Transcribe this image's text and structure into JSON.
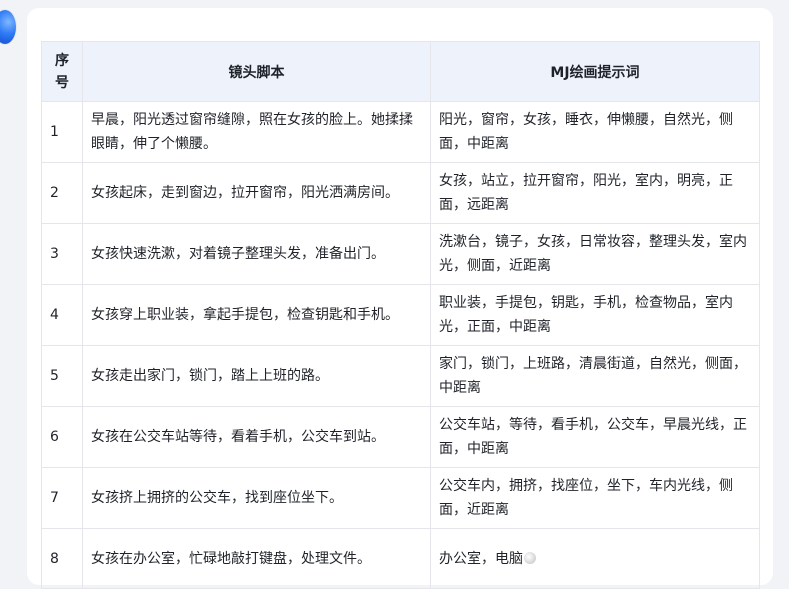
{
  "table": {
    "headers": [
      "序号",
      "镜头脚本",
      "MJ绘画提示词"
    ],
    "rows": [
      {
        "num": "1",
        "script": "早晨，阳光透过窗帘缝隙，照在女孩的脸上。她揉揉眼睛，伸了个懒腰。",
        "prompt": "阳光，窗帘，女孩，睡衣，伸懒腰，自然光，侧面，中距离"
      },
      {
        "num": "2",
        "script": "女孩起床，走到窗边，拉开窗帘，阳光洒满房间。",
        "prompt": "女孩，站立，拉开窗帘，阳光，室内，明亮，正面，远距离"
      },
      {
        "num": "3",
        "script": "女孩快速洗漱，对着镜子整理头发，准备出门。",
        "prompt": "洗漱台，镜子，女孩，日常妆容，整理头发，室内光，侧面，近距离"
      },
      {
        "num": "4",
        "script": "女孩穿上职业装，拿起手提包，检查钥匙和手机。",
        "prompt": "职业装，手提包，钥匙，手机，检查物品，室内光，正面，中距离"
      },
      {
        "num": "5",
        "script": "女孩走出家门，锁门，踏上上班的路。",
        "prompt": "家门，锁门，上班路，清晨街道，自然光，侧面，中距离"
      },
      {
        "num": "6",
        "script": "女孩在公交车站等待，看着手机，公交车到站。",
        "prompt": "公交车站，等待，看手机，公交车，早晨光线，正面，中距离"
      },
      {
        "num": "7",
        "script": "女孩挤上拥挤的公交车，找到座位坐下。",
        "prompt": "公交车内，拥挤，找座位，坐下，车内光线，侧面，近距离"
      },
      {
        "num": "8",
        "script": "女孩在办公室，忙碌地敲打键盘，处理文件。",
        "prompt": "办公室，电脑"
      }
    ]
  }
}
